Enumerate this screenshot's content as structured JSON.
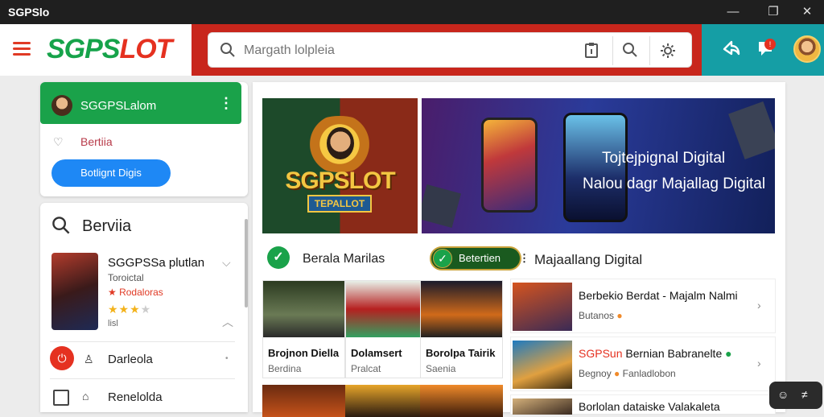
{
  "window": {
    "title": "SGPSlo"
  },
  "header": {
    "logo_main": "SGPS",
    "logo_accent": "LOT",
    "search_placeholder": "Margath lolpleia",
    "notification_count": "!"
  },
  "sidebar": {
    "profile_name": "SGGPSLalom",
    "bookmark_label": "Bertiia",
    "primary_button": "Botlignt Digis",
    "section_title": "Berviia",
    "game": {
      "title": "SGGPSSa plutlan",
      "subtitle": "Toroictal",
      "badge": "Rodaloras",
      "stars_on": "★★★",
      "stars_off": "★",
      "count": "lisl"
    },
    "row1_label": "Darleola",
    "row2_label": "Renelolda"
  },
  "main": {
    "banner_left": {
      "title": "SGPSLOT",
      "tag": "TEPALLOT"
    },
    "banner_right": {
      "line1": "Tojtejpignal Digital",
      "line2": "Nalou dagr Majallag Digital"
    },
    "features": {
      "item1": "Berala Marilas",
      "pill": "Betertien",
      "pill_dots": "⋮",
      "item3": "Majaallang Digital"
    },
    "tiles": [
      {
        "title": "Brojnon Diella",
        "sub": "Berdina"
      },
      {
        "title": "Dolamsert",
        "sub": "Pralcat"
      },
      {
        "title": "Borolpa Tairik",
        "sub": "Saenia"
      }
    ],
    "news": [
      {
        "title": "Berbekio Berdat - Majalm Nalmi",
        "sub": "Butanos"
      },
      {
        "title_red": "SGPSun",
        "title_rest": " Bernian Babranelte",
        "sub": "Begnoy",
        "sub2": "Fanladlobon"
      },
      {
        "title": "Borlolan dataiske Valakaleta",
        "sub": ""
      }
    ]
  },
  "float": {
    "left": "☺",
    "right": "≠"
  }
}
